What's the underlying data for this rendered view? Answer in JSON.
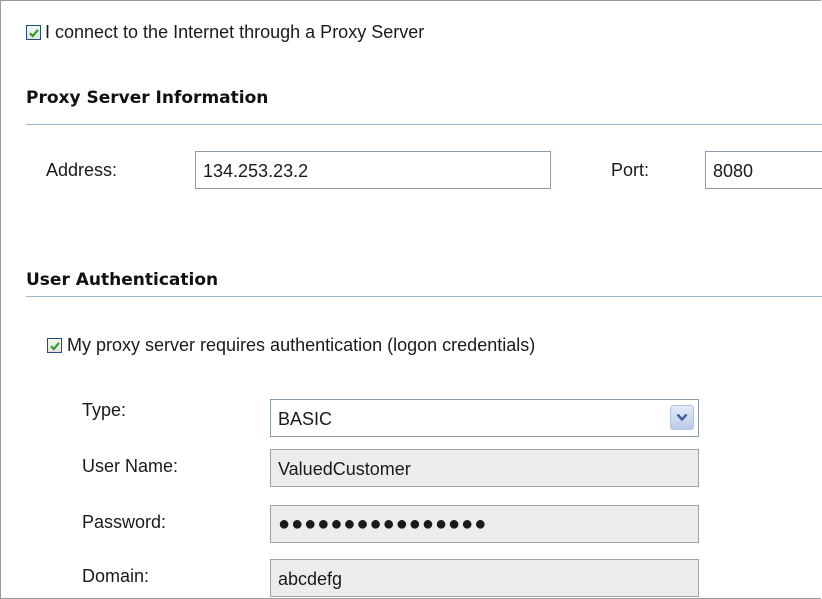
{
  "proxy": {
    "use_proxy_label": "I connect to the Internet through a Proxy Server",
    "use_proxy_checked": true
  },
  "proxy_info": {
    "title": "Proxy Server Information",
    "address_label": "Address:",
    "address_value": "134.253.23.2",
    "port_label": "Port:",
    "port_value": "8080"
  },
  "auth": {
    "title": "User Authentication",
    "requires_auth_label": "My proxy server requires authentication (logon credentials)",
    "requires_auth_checked": true,
    "type_label": "Type:",
    "type_value": "BASIC",
    "username_label": "User Name:",
    "username_value": "ValuedCustomer",
    "password_label": "Password:",
    "password_value": "●●●●●●●●●●●●●●●●",
    "domain_label": "Domain:",
    "domain_value": "abcdefg"
  },
  "icons": {
    "checkbox_check": "check-icon",
    "dropdown": "chevron-down-icon"
  },
  "colors": {
    "check": "#2f9e2f",
    "rule": "#9cb7cf",
    "readonly_bg": "#ececec"
  }
}
